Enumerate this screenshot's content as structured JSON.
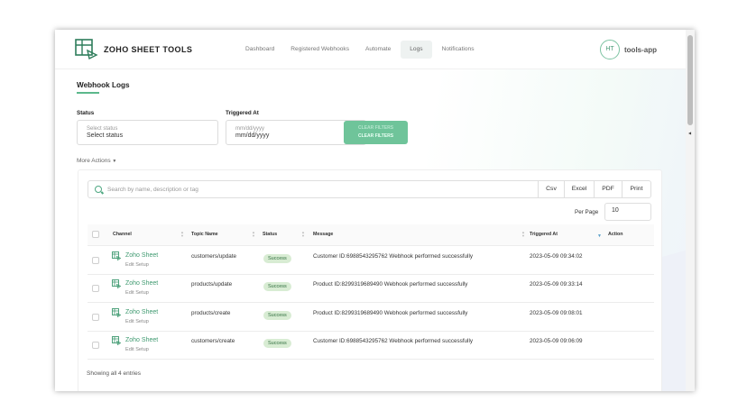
{
  "app": {
    "brand": "ZOHO SHEET TOOLS",
    "avatar_initials": "HT",
    "app_name": "tools-app",
    "accent_color": "#5cb88c"
  },
  "nav": {
    "items": [
      {
        "label": "Dashboard"
      },
      {
        "label": "Registered Webhooks"
      },
      {
        "label": "Automate"
      },
      {
        "label": "Logs",
        "active": true
      },
      {
        "label": "Notifications"
      }
    ]
  },
  "page": {
    "title": "Webhook Logs"
  },
  "filters": {
    "status_label": "Status",
    "status_placeholder": "Select status",
    "status_value": "Select status",
    "triggered_label": "Triggered At",
    "triggered_placeholder": "mm/dd/yyyy",
    "triggered_value": "mm/dd/yyyy",
    "clear_label": "CLEAR FILTERS",
    "more_actions": "More Actions"
  },
  "toolbar": {
    "search_placeholder": "Search by name, description or tag",
    "exports": [
      "Csv",
      "Excel",
      "PDF",
      "Print"
    ],
    "per_page_label": "Per Page",
    "per_page_value": "10"
  },
  "table": {
    "columns": [
      "Channel",
      "Topic Name",
      "Status",
      "Message",
      "Triggered At",
      "Action"
    ],
    "rows": [
      {
        "channel": "Zoho Sheet",
        "sub": "Edit Setup",
        "topic": "customers/update",
        "status": "Success",
        "message": "Customer ID:6988543295762 Webhook performed successfully",
        "triggered": "2023-05-09 09:34:02"
      },
      {
        "channel": "Zoho Sheet",
        "sub": "Edit Setup",
        "topic": "products/update",
        "status": "Success",
        "message": "Product ID:8299319689490 Webhook performed successfully",
        "triggered": "2023-05-09 09:33:14"
      },
      {
        "channel": "Zoho Sheet",
        "sub": "Edit Setup",
        "topic": "products/create",
        "status": "Success",
        "message": "Product ID:8299319689490 Webhook performed successfully",
        "triggered": "2023-05-09 09:08:01"
      },
      {
        "channel": "Zoho Sheet",
        "sub": "Edit Setup",
        "topic": "customers/create",
        "status": "Success",
        "message": "Customer ID:6988543295762 Webhook performed successfully",
        "triggered": "2023-05-09 09:06:09"
      }
    ],
    "footer": "Showing all 4 entries"
  }
}
